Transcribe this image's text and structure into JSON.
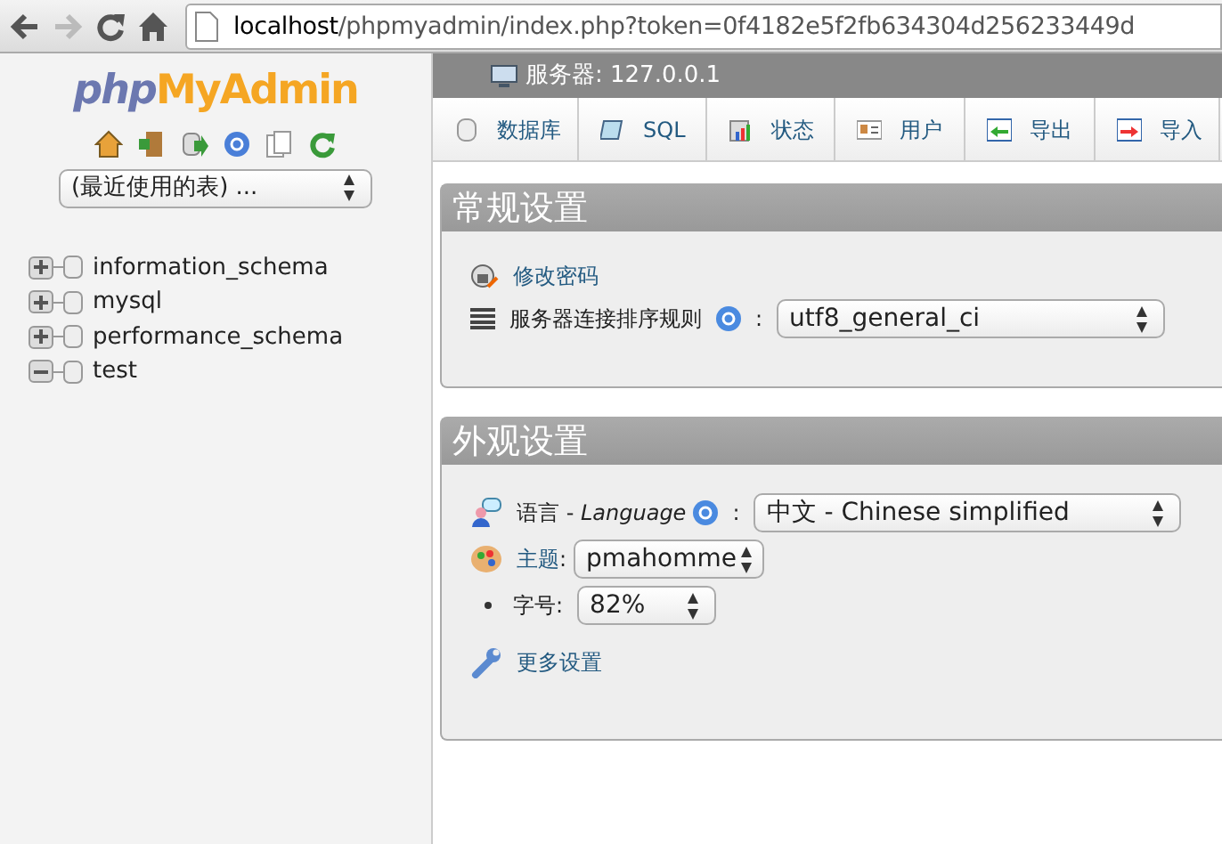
{
  "browser": {
    "url_host": "localhost",
    "url_path": "/phpmyadmin/index.php?token=0f4182e5f2fb634304d256233449d"
  },
  "sidebar": {
    "logo_php": "php",
    "logo_name": "MyAdmin",
    "recent_tables": "(最近使用的表) ...",
    "databases": [
      {
        "name": "information_schema",
        "expanded": false
      },
      {
        "name": "mysql",
        "expanded": false
      },
      {
        "name": "performance_schema",
        "expanded": false
      },
      {
        "name": "test",
        "expanded": true
      }
    ]
  },
  "server_bar": {
    "label": "服务器: 127.0.0.1"
  },
  "tabs": [
    {
      "label": "数据库",
      "kind": "db"
    },
    {
      "label": "SQL",
      "kind": "sql"
    },
    {
      "label": "状态",
      "kind": "status"
    },
    {
      "label": "用户",
      "kind": "users"
    },
    {
      "label": "导出",
      "kind": "export"
    },
    {
      "label": "导入",
      "kind": "import"
    }
  ],
  "general_settings": {
    "title": "常规设置",
    "change_password": "修改密码",
    "collation_label": "服务器连接排序规则",
    "colon": ":",
    "collation_value": "utf8_general_ci"
  },
  "appearance_settings": {
    "title": "外观设置",
    "language_label": "语言 - *Language*",
    "colon": ":",
    "language_value": "中文 - Chinese simplified",
    "theme_label": "主题",
    "theme_colon": ":",
    "theme_value": "pmahomme",
    "font_size_label": "字号:",
    "font_size_value": "82%",
    "more_settings": "更多设置"
  }
}
